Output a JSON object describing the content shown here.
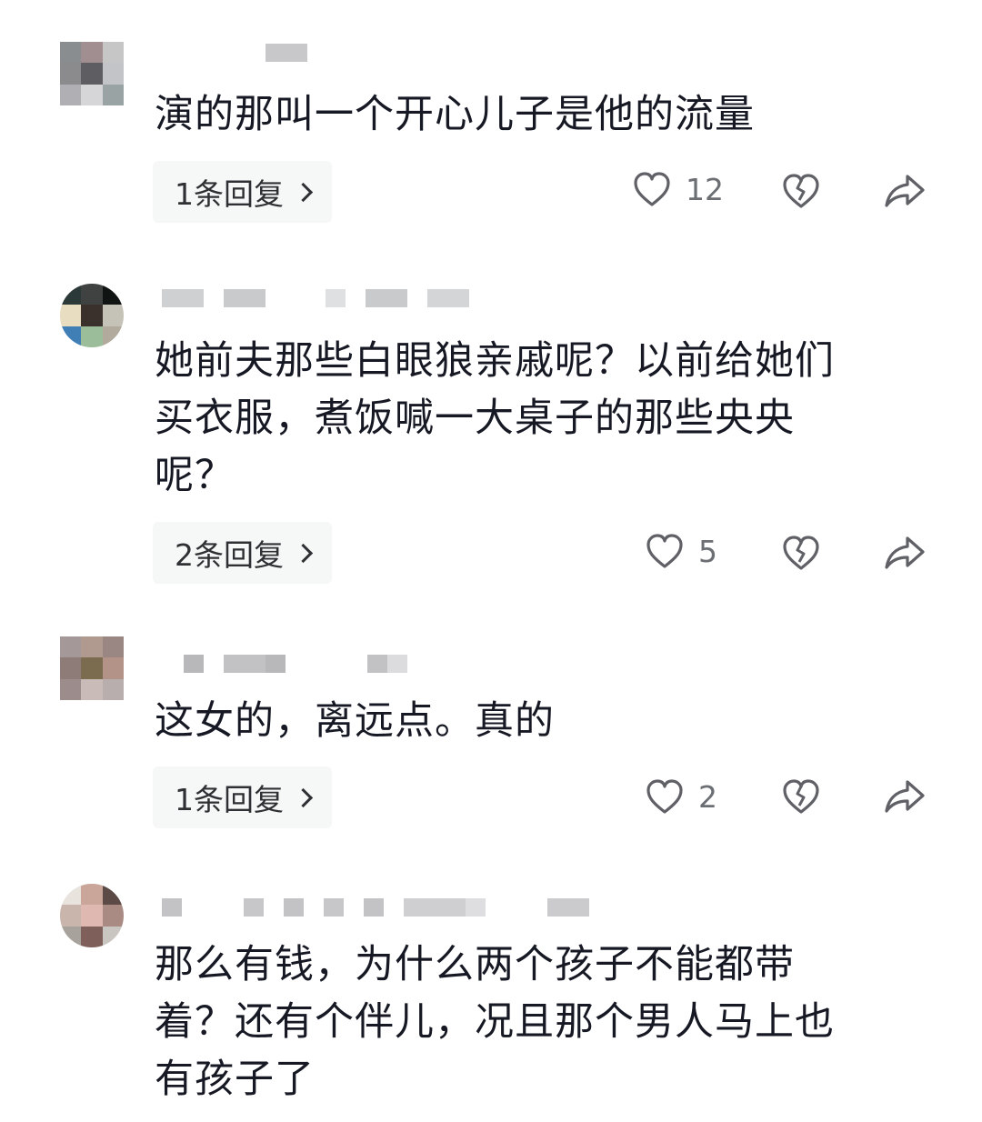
{
  "comments": [
    {
      "text": "演的那叫一个开心儿子是他的流量",
      "reply_label": "1条回复",
      "likes": "12",
      "avatar_colors": [
        "#8a8d8f",
        "#a08e90",
        "#c6c6c6",
        "#8b8a8d",
        "#5e5e62",
        "#c3c4c8",
        "#b0afb3",
        "#d6d6d8",
        "#9aa3a4"
      ],
      "name_blur_colors": [
        "#c8c8ca",
        "#d8d8da"
      ]
    },
    {
      "text": "她前夫那些白眼狼亲戚呢？以前给她们\n买衣服，煮饭喊一大桌子的那些央央\n呢？",
      "reply_label": "2条回复",
      "likes": "5",
      "avatar_colors": [
        "#2b3a38",
        "#404242",
        "#101413",
        "#e8dcc1",
        "#3b312c",
        "#c5c3b7",
        "#3f7fb5",
        "#9bbd9a",
        "#b2aa9c"
      ],
      "name_blur_colors": [
        "#cfd0d2",
        "#dfe0e2",
        "#c9cacc"
      ]
    },
    {
      "text": "这女的，离远点。真的",
      "reply_label": "1条回复",
      "likes": "2",
      "avatar_colors": [
        "#a49998",
        "#b09a90",
        "#9a8683",
        "#8e7c78",
        "#7c6c4f",
        "#b39387",
        "#9c8c8b",
        "#c8bbb8",
        "#b9aeae"
      ],
      "name_blur_colors": [
        "#b8b8ba",
        "#cfcfd1"
      ]
    },
    {
      "text": "那么有钱，为什么两个孩子不能都带\n着？还有个伴儿，况且那个男人马上也\n有孩子了",
      "avatar_colors": [
        "#e8e3dd",
        "#c9a59a",
        "#5b4a46",
        "#c9b5ac",
        "#e0b8b2",
        "#a98b84",
        "#a8a29d",
        "#7f5f5a",
        "#c9c5c1"
      ],
      "name_blur_colors": [
        "#c3c3c5",
        "#d6d6d8",
        "#c7c7c9"
      ]
    }
  ],
  "icons": {
    "like": "heart-outline-icon",
    "dislike": "broken-heart-icon",
    "share": "share-arrow-icon"
  }
}
